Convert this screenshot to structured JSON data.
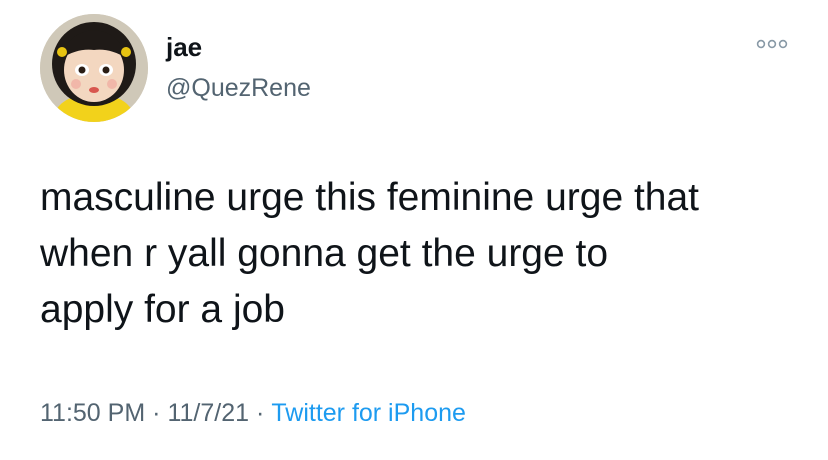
{
  "user": {
    "display_name": "jae",
    "handle": "@QuezRene",
    "avatar_icon": "doll-avatar"
  },
  "tweet": {
    "text": "masculine urge this feminine urge that\nwhen r yall gonna get the urge to\napply for a job",
    "time": "11:50 PM",
    "date": "11/7/21",
    "separator": "·",
    "source": "Twitter for iPhone"
  },
  "icons": {
    "more": "more-options-icon"
  },
  "colors": {
    "text_primary": "#0f1419",
    "text_secondary": "#536471",
    "link": "#1d9bf0"
  }
}
